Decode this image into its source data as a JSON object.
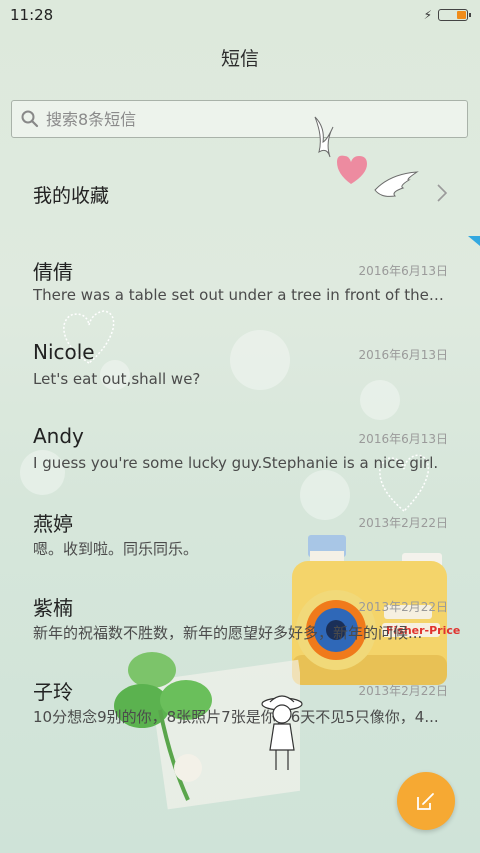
{
  "status_bar": {
    "time": "11:28",
    "battery_color": "#f08c1a"
  },
  "header": {
    "title": "短信"
  },
  "search": {
    "placeholder": "搜索8条短信"
  },
  "favorites": {
    "label": "我的收藏"
  },
  "threads": [
    {
      "name": "倩倩",
      "date": "2016年6月13日",
      "snippet": "There was a table set out under a tree in front of the ho..."
    },
    {
      "name": "Nicole",
      "date": "2016年6月13日",
      "snippet": "Let's eat out,shall we?"
    },
    {
      "name": "Andy",
      "date": "2016年6月13日",
      "snippet": "I guess you're some lucky guy.Stephanie is a nice girl."
    },
    {
      "name": "燕婷",
      "date": "2013年2月22日",
      "snippet": "嗯。收到啦。同乐同乐。"
    },
    {
      "name": "紫楠",
      "date": "2013年2月22日",
      "snippet": "新年的祝福数不胜数，新年的愿望好多好多，新年的问候..."
    },
    {
      "name": "子玲",
      "date": "2013年2月22日",
      "snippet": "10分想念9别的你，8张照片7张是你，6天不见5只像你，4..."
    }
  ],
  "compose": {
    "icon": "compose-icon",
    "color": "#f6a933"
  },
  "decorations": {
    "camera_brand": "Fisher-Price"
  }
}
